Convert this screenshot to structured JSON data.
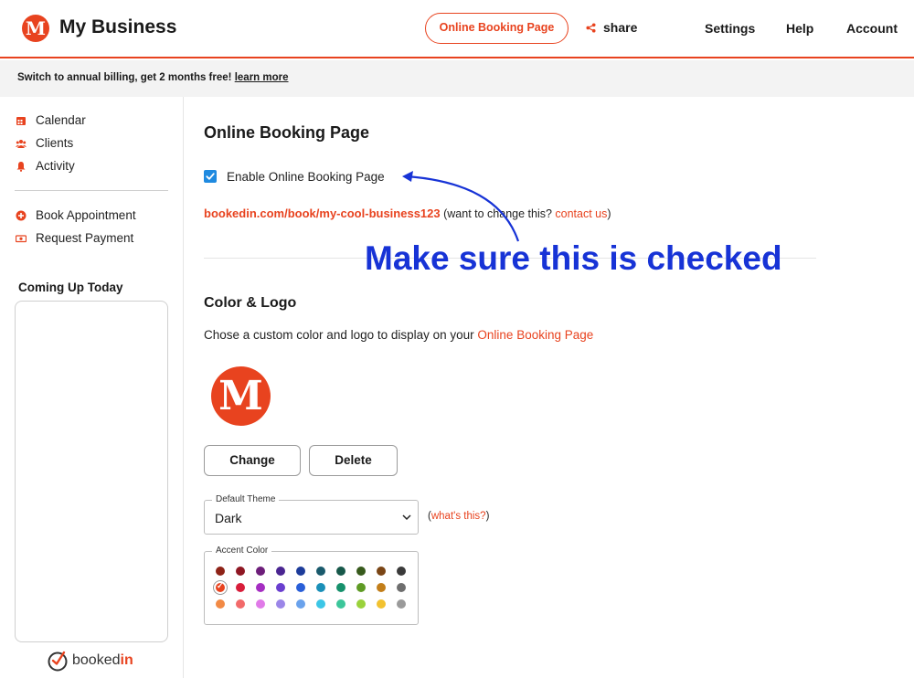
{
  "header": {
    "logo_letter": "M",
    "brand": "My Business",
    "online_booking_button": "Online Booking Page",
    "share": "share",
    "nav": [
      "Settings",
      "Help",
      "Account"
    ]
  },
  "banner": {
    "text": "Switch to annual billing, get 2 months free!",
    "link": "learn more"
  },
  "sidebar": {
    "items": [
      {
        "label": "Calendar",
        "icon": "calendar-icon"
      },
      {
        "label": "Clients",
        "icon": "clients-icon"
      },
      {
        "label": "Activity",
        "icon": "bell-icon"
      }
    ],
    "actions": [
      {
        "label": "Book Appointment",
        "icon": "plus-circle-icon"
      },
      {
        "label": "Request Payment",
        "icon": "money-icon"
      }
    ],
    "coming_up_title": "Coming Up Today",
    "footer_brand_a": "booked",
    "footer_brand_b": "in"
  },
  "main": {
    "title": "Online Booking Page",
    "enable_label": "Enable Online Booking Page",
    "enable_checked": true,
    "url": "bookedin.com/book/my-cool-business123",
    "url_note_prefix": " (want to change this? ",
    "url_note_link": "contact us",
    "url_note_suffix": ")",
    "color_logo_title": "Color & Logo",
    "description": "Chose a custom color and logo to display on your ",
    "description_link": "Online Booking Page",
    "logo_letter": "M",
    "change_button": "Change",
    "delete_button": "Delete",
    "theme_legend": "Default Theme",
    "theme_value": "Dark",
    "whats_this_prefix": "(",
    "whats_this_link": "what's this?",
    "whats_this_suffix": ")",
    "accent_legend": "Accent Color",
    "accent_selected_index": 10,
    "accent_colors": [
      "#8e2317",
      "#8f1723",
      "#6d1e7a",
      "#4a2591",
      "#1d3c9a",
      "#1a5a6c",
      "#17584a",
      "#375a1c",
      "#7a4515",
      "#3a3a3a",
      "#e8431f",
      "#d81e3a",
      "#a52ec2",
      "#6a3fcf",
      "#2a5fd8",
      "#1b90b8",
      "#17916c",
      "#5f9b25",
      "#c27e1a",
      "#6e6e6e",
      "#f28a45",
      "#f26a6a",
      "#e07ae8",
      "#9b86e8",
      "#6aa2ec",
      "#3cc6e6",
      "#3cc69a",
      "#9ad23c",
      "#f2c230",
      "#9a9a9a"
    ]
  },
  "annotation": {
    "text": "Make sure this is checked",
    "color": "#1733d6"
  }
}
